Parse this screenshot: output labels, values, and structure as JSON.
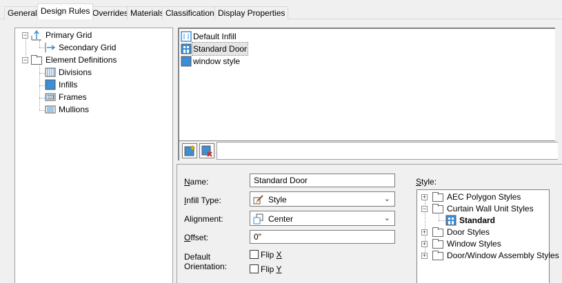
{
  "tabs": [
    {
      "label": "General"
    },
    {
      "label": "Design Rules"
    },
    {
      "label": "Overrides"
    },
    {
      "label": "Materials"
    },
    {
      "label": "Classifications"
    },
    {
      "label": "Display Properties"
    }
  ],
  "left_tree": {
    "items": [
      {
        "label": "Primary Grid"
      },
      {
        "label": "Secondary Grid"
      },
      {
        "label": "Element Definitions"
      },
      {
        "label": "Divisions"
      },
      {
        "label": "Infills"
      },
      {
        "label": "Frames"
      },
      {
        "label": "Mullions"
      }
    ]
  },
  "infill_list": {
    "items": [
      {
        "label": "Default Infill"
      },
      {
        "label": "Standard Door"
      },
      {
        "label": "window style"
      }
    ]
  },
  "props": {
    "name_label_pre": "",
    "name_label_u": "N",
    "name_label_post": "ame:",
    "name_value": "Standard Door",
    "infill_type_label_pre": "",
    "infill_type_label_u": "I",
    "infill_type_label_post": "nfill Type:",
    "infill_type_value": "Style",
    "alignment_label_pre": "Ali",
    "alignment_label_u": "g",
    "alignment_label_post": "nment:",
    "alignment_value": "Center",
    "offset_label_pre": "",
    "offset_label_u": "O",
    "offset_label_post": "ffset:",
    "offset_value": "0\"",
    "default_orientation_line1": "Default",
    "default_orientation_line2": "Orientation:",
    "flip_x_pre": "Flip ",
    "flip_x_u": "X",
    "flip_y_pre": "Flip ",
    "flip_y_u": "Y",
    "style_label_pre": "",
    "style_label_u": "S",
    "style_label_post": "tyle:"
  },
  "style_tree": {
    "items": [
      {
        "label": "AEC Polygon Styles"
      },
      {
        "label": "Curtain Wall Unit Styles"
      },
      {
        "label": "Standard"
      },
      {
        "label": "Door Styles"
      },
      {
        "label": "Window Styles"
      },
      {
        "label": "Door/Window Assembly Styles"
      }
    ]
  },
  "colors": {
    "accent_blue": "#3c8fd6",
    "panel_border": "#a0a0a0"
  }
}
